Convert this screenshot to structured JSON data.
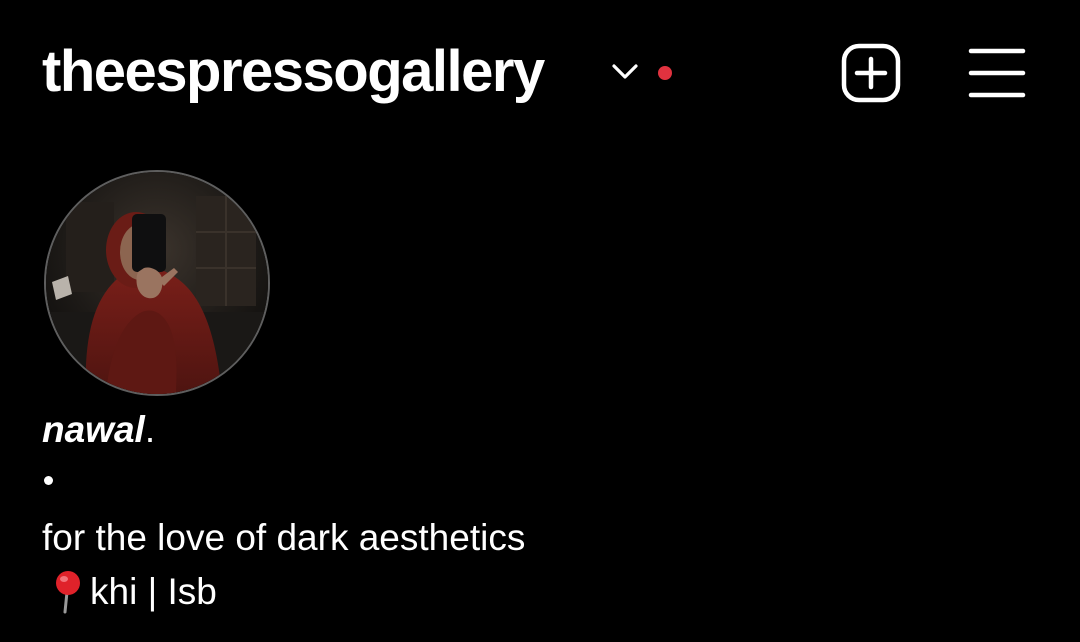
{
  "header": {
    "username": "theespressogallery",
    "account_switcher_icon": "chevron-down-icon",
    "notification_dot_color": "#e0323f",
    "create_icon": "plus-square-icon",
    "menu_icon": "hamburger-menu-icon"
  },
  "profile": {
    "avatar_icon": "profile-photo",
    "display_name": "nawal",
    "display_name_suffix": ".",
    "bio": {
      "bullet_icon": "bullet-dot-icon",
      "line_1": "for the love of dark aesthetics",
      "location_icon": "red-pushpin-icon",
      "location_text": "khi | Isb"
    }
  },
  "colors": {
    "background": "#000000",
    "text": "#ffffff",
    "avatar_ring": "#5e5e5e"
  }
}
